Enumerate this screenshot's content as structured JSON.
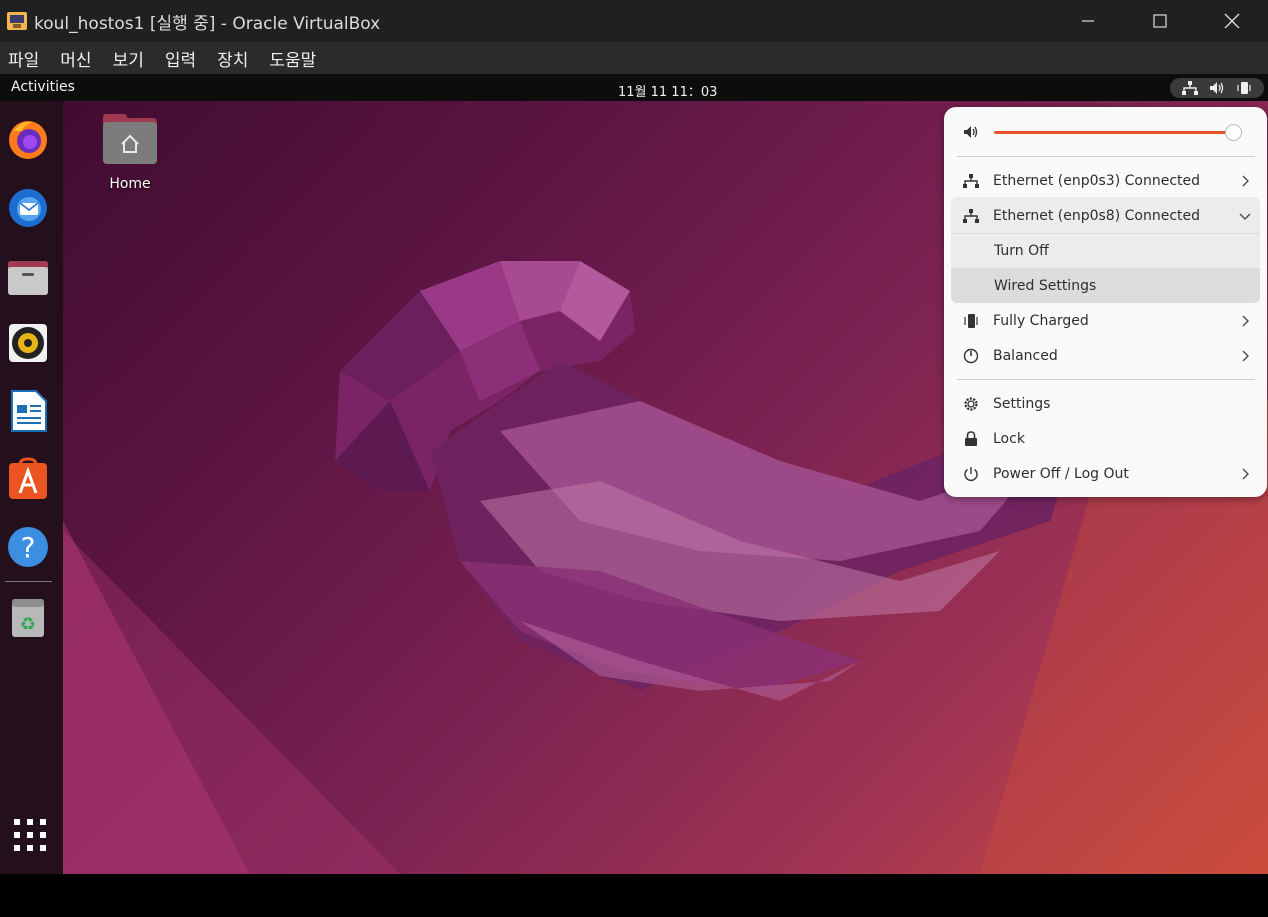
{
  "host_window": {
    "title": "koul_hostos1 [실행 중] - Oracle VirtualBox",
    "menu": [
      "파일",
      "머신",
      "보기",
      "입력",
      "장치",
      "도움말"
    ]
  },
  "topbar": {
    "activities": "Activities",
    "clock": "11월 11  11：03"
  },
  "desktop": {
    "home_label": "Home"
  },
  "dock": {
    "apps": [
      "firefox-icon",
      "thunderbird-icon",
      "files-icon",
      "rhythmbox-icon",
      "writer-icon",
      "software-icon",
      "help-icon",
      "trash-icon"
    ]
  },
  "quick_settings": {
    "volume_level": 0.98,
    "ethernet1": "Ethernet (enp0s3) Connected",
    "ethernet2": "Ethernet (enp0s8) Connected",
    "turn_off": "Turn Off",
    "wired_settings": "Wired Settings",
    "battery": "Fully Charged",
    "power_mode": "Balanced",
    "settings": "Settings",
    "lock": "Lock",
    "power_off": "Power Off / Log Out"
  },
  "colors": {
    "accent": "#e8542a",
    "panel_bg": "#fafafa"
  }
}
